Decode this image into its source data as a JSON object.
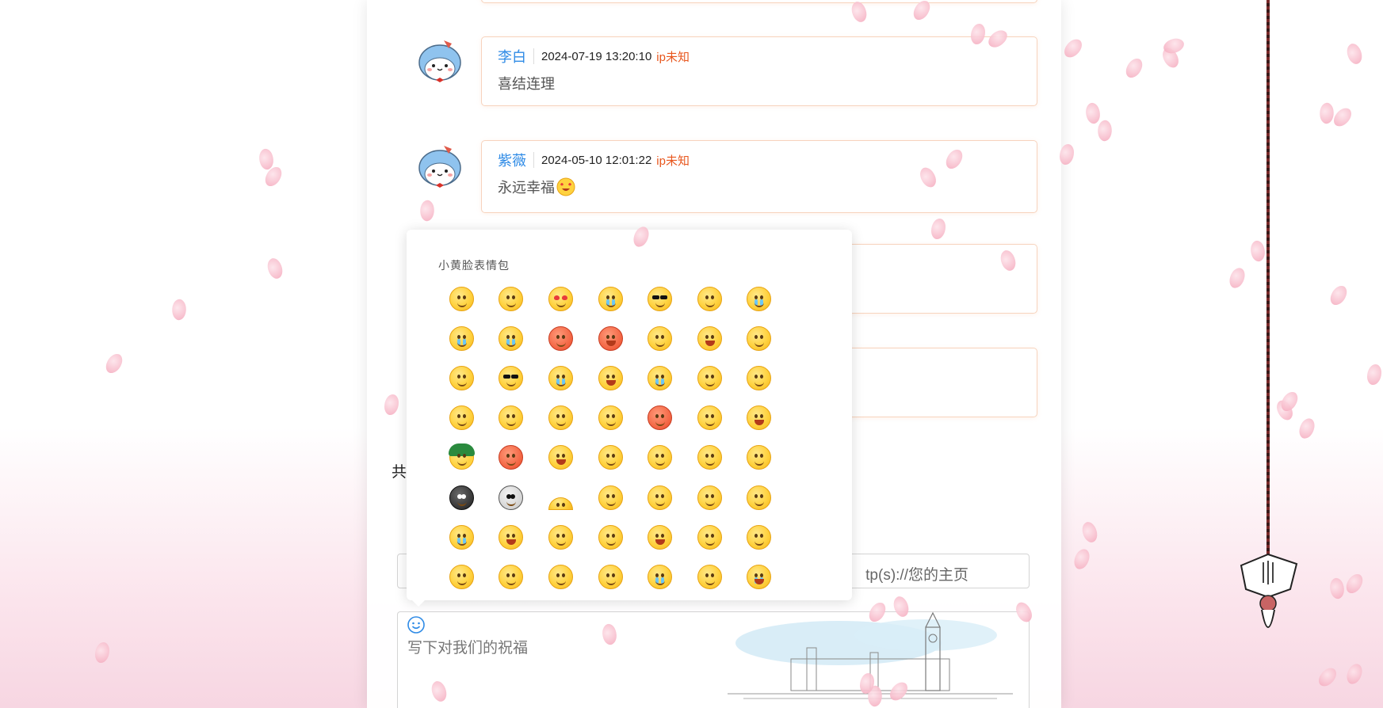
{
  "comments": [
    {
      "username": "李白",
      "datetime": "2024-07-19 13:20:10",
      "ip": "ip未知",
      "text": "喜结连理",
      "emoji": ""
    },
    {
      "username": "紫薇",
      "datetime": "2024-05-10 12:01:22",
      "ip": "ip未知",
      "text": "永远幸福",
      "emoji": "heart-eyes-emoji"
    }
  ],
  "total_label": "共",
  "form": {
    "homepage_placeholder": "http(s)://您的主页",
    "homepage_visible_text": "tp(s)://您的主页",
    "message_placeholder": "写下对我们的祝福"
  },
  "emoji_panel": {
    "title": "小黄脸表情包",
    "rows": 8,
    "columns": 7
  },
  "colors": {
    "username": "#2f8be6",
    "ip": "#e8571e",
    "card_border": "#f7d3bd",
    "petal": "#f7b9c9"
  }
}
